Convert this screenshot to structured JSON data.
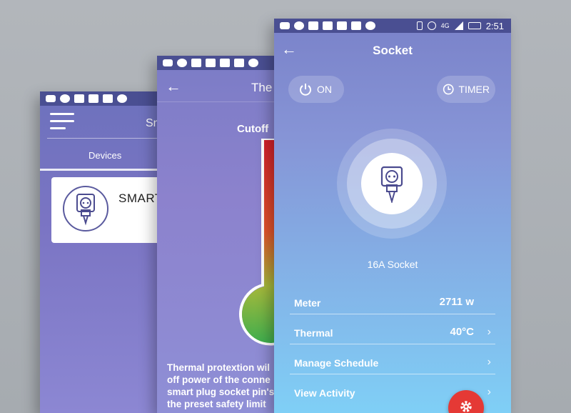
{
  "statusbar": {
    "network": "4G",
    "time": "2:51"
  },
  "screen_list": {
    "title": "Sn",
    "tab": "Devices",
    "card_label": "SMART"
  },
  "screen_thermal": {
    "title": "The",
    "heading": "Cutoff",
    "description": [
      "Thermal protextion wil",
      "off power of the conne",
      "smart plug socket pin's",
      "the preset safety limit"
    ]
  },
  "screen_socket": {
    "title": "Socket",
    "power_button": "ON",
    "timer_button": "TIMER",
    "device_name": "16A Socket",
    "rows": [
      {
        "label": "Meter",
        "value": "2711 w"
      },
      {
        "label": "Thermal",
        "value": "40°C"
      },
      {
        "label": "Manage Schedule",
        "value": ""
      },
      {
        "label": "View Activity",
        "value": ""
      }
    ]
  },
  "colors": {
    "statusbar": "#4a4f92",
    "fab": "#e53935",
    "thermo_hot": "#d32f2f",
    "thermo_cool": "#4caf50"
  },
  "icons": [
    "menu-icon",
    "back-arrow-icon",
    "power-icon",
    "clock-icon",
    "socket-plug-icon",
    "chevron-right-icon",
    "gear-icon"
  ]
}
